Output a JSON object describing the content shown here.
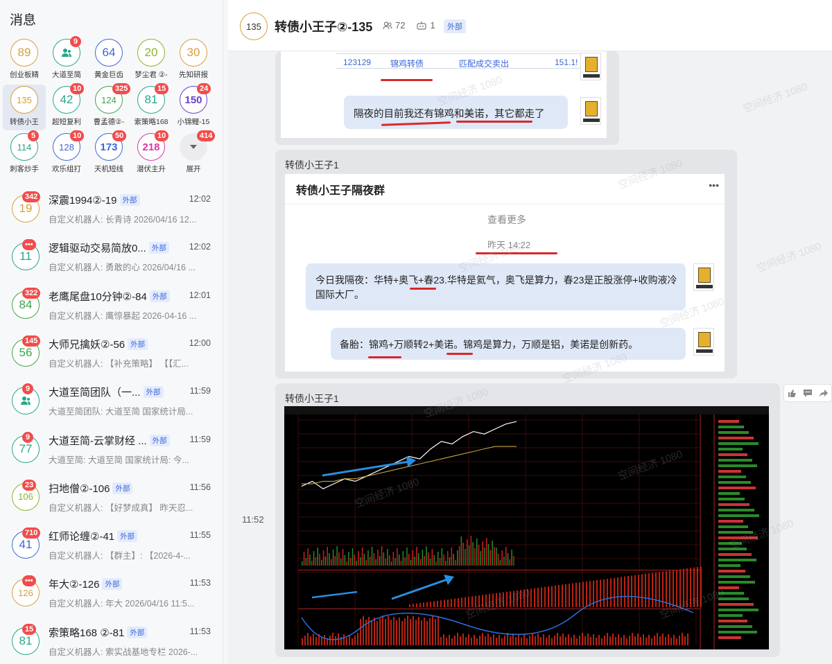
{
  "sidebar": {
    "title": "消息",
    "grid": [
      {
        "value": "89",
        "label": "创业板精",
        "badge": "",
        "color": "#d4a03b"
      },
      {
        "value": "",
        "label": "大道至简",
        "badge": "9",
        "color": "#25a78a",
        "icon": "group-icon"
      },
      {
        "value": "64",
        "label": "黄金巨齿",
        "badge": "",
        "color": "#3a66d9"
      },
      {
        "value": "20",
        "label": "梦尘君 ②-",
        "badge": "",
        "color": "#8ab32a"
      },
      {
        "value": "30",
        "label": "先知研报",
        "badge": "",
        "color": "#d4a03b"
      },
      {
        "value": "135",
        "label": "转债小王",
        "badge": "",
        "color": "#d4a03b",
        "selected": true
      },
      {
        "value": "42",
        "label": "超短复利",
        "badge": "10",
        "color": "#25a78a"
      },
      {
        "value": "124",
        "label": "曹孟德②-",
        "badge": "325",
        "color": "#3da34a"
      },
      {
        "value": "81",
        "label": "索策略168",
        "badge": "15",
        "color": "#25a78a"
      },
      {
        "value": "150",
        "label": "小锦鲤-15",
        "badge": "24",
        "color": "#6a3fd1"
      },
      {
        "value": "114",
        "label": "刺客炒手",
        "badge": "5",
        "color": "#25a78a"
      },
      {
        "value": "128",
        "label": "欢乐组打",
        "badge": "10",
        "color": "#3a66d9"
      },
      {
        "value": "173",
        "label": "天机短线",
        "badge": "50",
        "color": "#3a66d9"
      },
      {
        "value": "218",
        "label": "潜伏主升",
        "badge": "10",
        "color": "#d63aa0"
      },
      {
        "value": "",
        "label": "展开",
        "badge": "414",
        "color": "#ccc",
        "icon": "chevron-down-icon"
      }
    ],
    "conversations": [
      {
        "avatar": "19",
        "badge": "342",
        "title": "深震1994②-19",
        "ext": "外部",
        "time": "12:02",
        "sub": "自定义机器人: 长青诗 2026/04/16 12...",
        "color": "#d4a03b"
      },
      {
        "avatar": "11",
        "badge": "•••",
        "title": "逻辑驱动交易简放0...",
        "ext": "外部",
        "time": "12:02",
        "sub": "自定义机器人: 勇敢的心 2026/04/16 ...",
        "color": "#25a78a"
      },
      {
        "avatar": "84",
        "badge": "322",
        "title": "老鹰尾盘10分钟②-84",
        "ext": "外部",
        "time": "12:01",
        "sub": "自定义机器人: 鹰惊暴起 2026-04-16 ...",
        "color": "#3da34a"
      },
      {
        "avatar": "56",
        "badge": "145",
        "title": "大师兄擒妖②-56",
        "ext": "外部",
        "time": "12:00",
        "sub": "自定义机器人: 【补充策略】 【【汇...",
        "color": "#3da34a"
      },
      {
        "avatar": "",
        "badge": "9",
        "title": "大道至简团队（一...",
        "ext": "外部",
        "time": "11:59",
        "sub": "大道至简团队: 大道至简 国家统计局...",
        "color": "#25a78a",
        "icon": "group-icon"
      },
      {
        "avatar": "77",
        "badge": "9",
        "title": "大道至简-云掌财经 ...",
        "ext": "外部",
        "time": "11:59",
        "sub": "大道至简: 大道至简 国家统计局: 今...",
        "color": "#25a78a"
      },
      {
        "avatar": "106",
        "badge": "23",
        "title": "扫地僧②-106",
        "ext": "外部",
        "time": "11:56",
        "sub": "自定义机器人: 【好梦成真】 昨天忍...",
        "color": "#8ab32a"
      },
      {
        "avatar": "41",
        "badge": "710",
        "title": "红师论缠②-41",
        "ext": "外部",
        "time": "11:55",
        "sub": "自定义机器人: 【群主】: 【2026-4-...",
        "color": "#3a66d9"
      },
      {
        "avatar": "126",
        "badge": "•••",
        "title": "年大②-126",
        "ext": "外部",
        "time": "11:53",
        "sub": "自定义机器人: 年大 2026/04/16 11:5...",
        "color": "#d4a03b"
      },
      {
        "avatar": "81",
        "badge": "15",
        "title": "索策略168 ②-81",
        "ext": "外部",
        "time": "11:53",
        "sub": "自定义机器人: 索实战基地专栏 2026-...",
        "color": "#25a78a"
      }
    ]
  },
  "header": {
    "avatar": "135",
    "title": "转债小王子②-135",
    "members": "72",
    "bots": "1",
    "ext": "外部"
  },
  "messages": {
    "top_row": {
      "code": "123129",
      "name": "锦鸡转债",
      "action": "匹配成交卖出",
      "price": "151.1!"
    },
    "top_bubble": "隔夜的目前我还有锦鸡和美诺，其它都走了",
    "msg2": {
      "sender": "转债小王子1",
      "group_title": "转债小王子隔夜群",
      "more": "•••",
      "view_more": "查看更多",
      "time": "昨天 14:22",
      "bubble1": "今日我隔夜：华特+奥飞+春23.华特是氦气，奥飞是算力，春23是正股涨停+收购液冷国际大厂。",
      "bubble2": "备胎：锦鸡+万顺转2+美诺。锦鸡是算力，万顺是铝，美诺是创新药。"
    },
    "msg3": {
      "sender": "转债小王子1",
      "time": "11:52"
    },
    "watermark": "空间经济 1080"
  },
  "chart_data": {
    "type": "line",
    "title": "",
    "series": [
      {
        "values": [
          140,
          142,
          139,
          141,
          143,
          142,
          144,
          146,
          148,
          150,
          152,
          151,
          155,
          158,
          157,
          160,
          162,
          161,
          163,
          165,
          166
        ]
      },
      {
        "values": [
          141,
          141,
          142,
          142,
          143,
          143,
          144,
          145,
          146,
          147,
          148,
          149,
          150,
          151,
          152,
          153,
          154,
          155,
          156,
          156,
          156
        ]
      }
    ]
  }
}
